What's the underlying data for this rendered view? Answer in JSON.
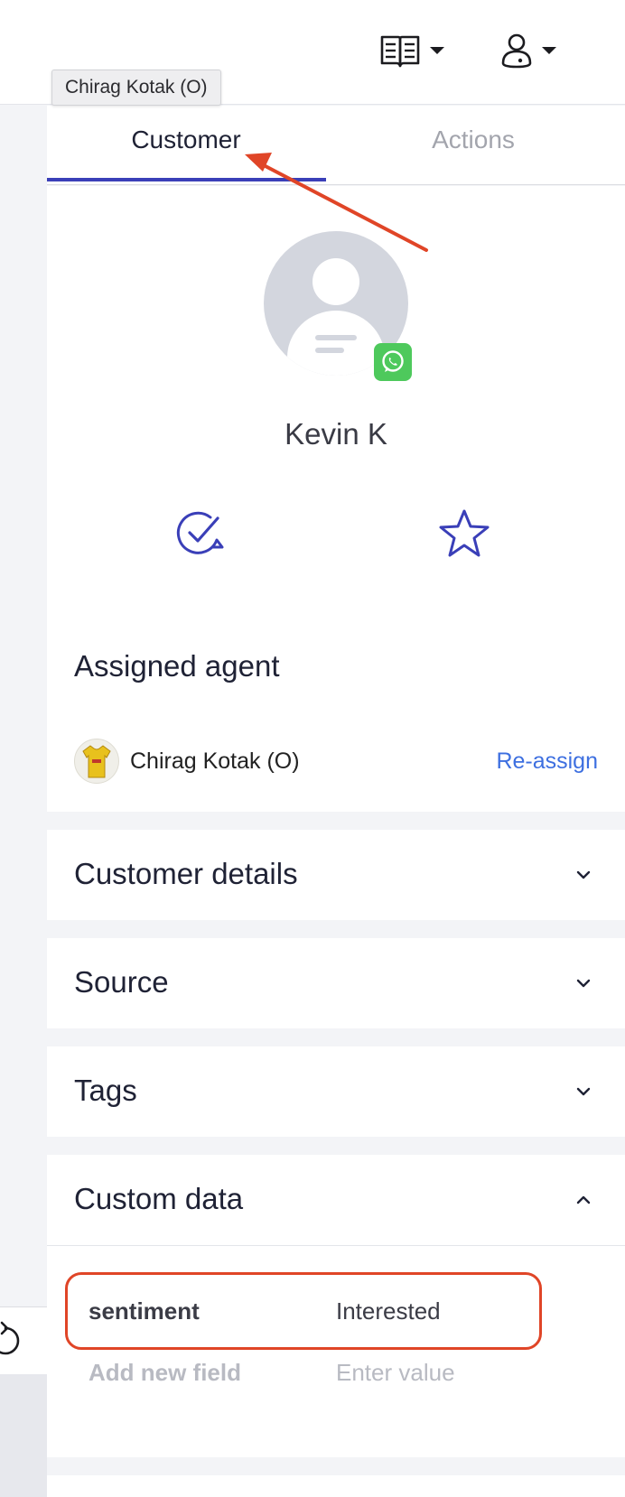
{
  "tooltip": {
    "text": "Chirag Kotak (O)"
  },
  "header": {
    "icons": [
      "book-icon",
      "user-icon"
    ]
  },
  "tabs": [
    {
      "label": "Customer",
      "active": true
    },
    {
      "label": "Actions",
      "active": false
    }
  ],
  "customer": {
    "name": "Kevin K",
    "channel_icon": "whatsapp-icon",
    "action_icons": [
      "resolve-chat-icon",
      "star-icon"
    ]
  },
  "assigned_agent": {
    "title": "Assigned agent",
    "agent_name": "Chirag Kotak (O)",
    "reassign_label": "Re-assign"
  },
  "sections": {
    "customer_details": "Customer details",
    "source": "Source",
    "tags": "Tags",
    "custom_data": "Custom data"
  },
  "custom_data": {
    "fields": [
      {
        "key": "sentiment",
        "value": "Interested"
      }
    ],
    "new_field_placeholder": "Add new field",
    "new_value_placeholder": "Enter value"
  },
  "colors": {
    "accent": "#3a3fb8",
    "link": "#3d6fe0",
    "whatsapp": "#4ec95c",
    "annotation": "#e04527"
  }
}
